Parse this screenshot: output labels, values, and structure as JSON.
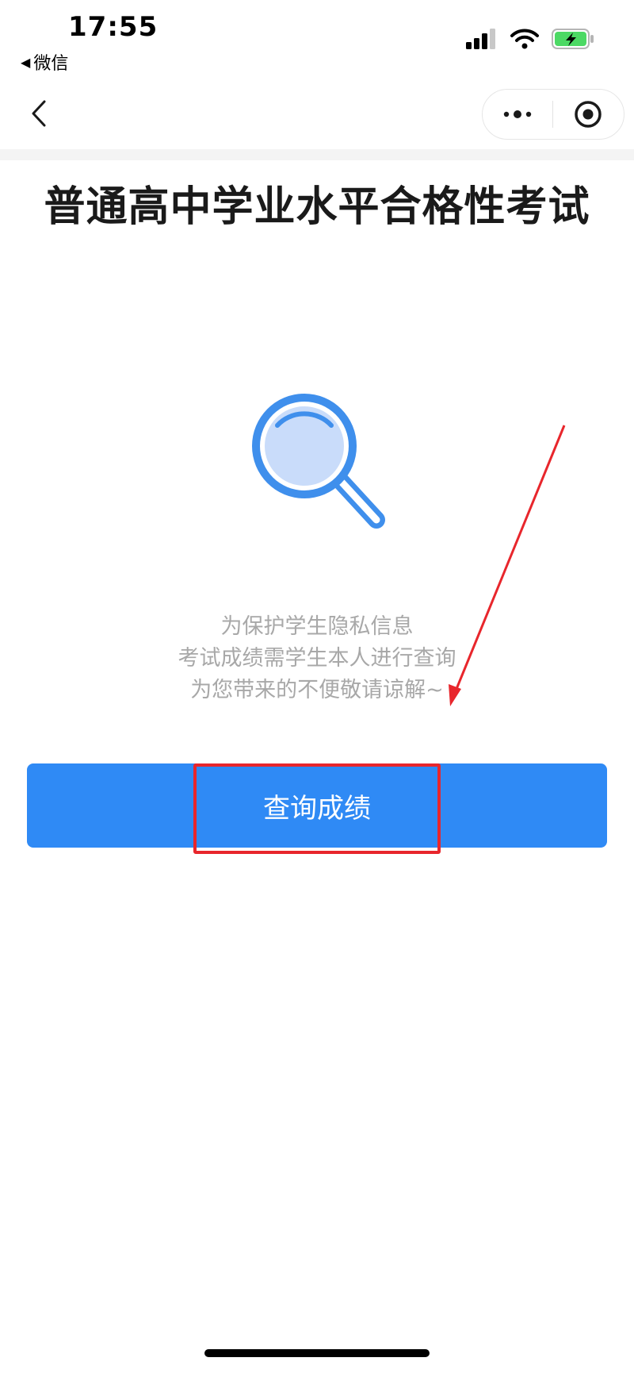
{
  "status_bar": {
    "time": "17:55",
    "back_app_label": "微信",
    "back_app_icon": "back-triangle-icon"
  },
  "nav": {
    "back_icon": "chevron-left-icon",
    "more_icon": "more-dots-icon",
    "close_icon": "target-circle-icon"
  },
  "page": {
    "title": "普通高中学业水平合格性考试",
    "illustration_icon": "magnifier-icon",
    "notice_lines": [
      "为保护学生隐私信息",
      "考试成绩需学生本人进行查询",
      "为您带来的不便敬请谅解~"
    ],
    "query_button_label": "查询成绩"
  },
  "colors": {
    "accent": "#2f8af5",
    "annotation_red": "#e8262c",
    "notice_text": "#a8a8a8",
    "battery_green": "#4cd964"
  }
}
